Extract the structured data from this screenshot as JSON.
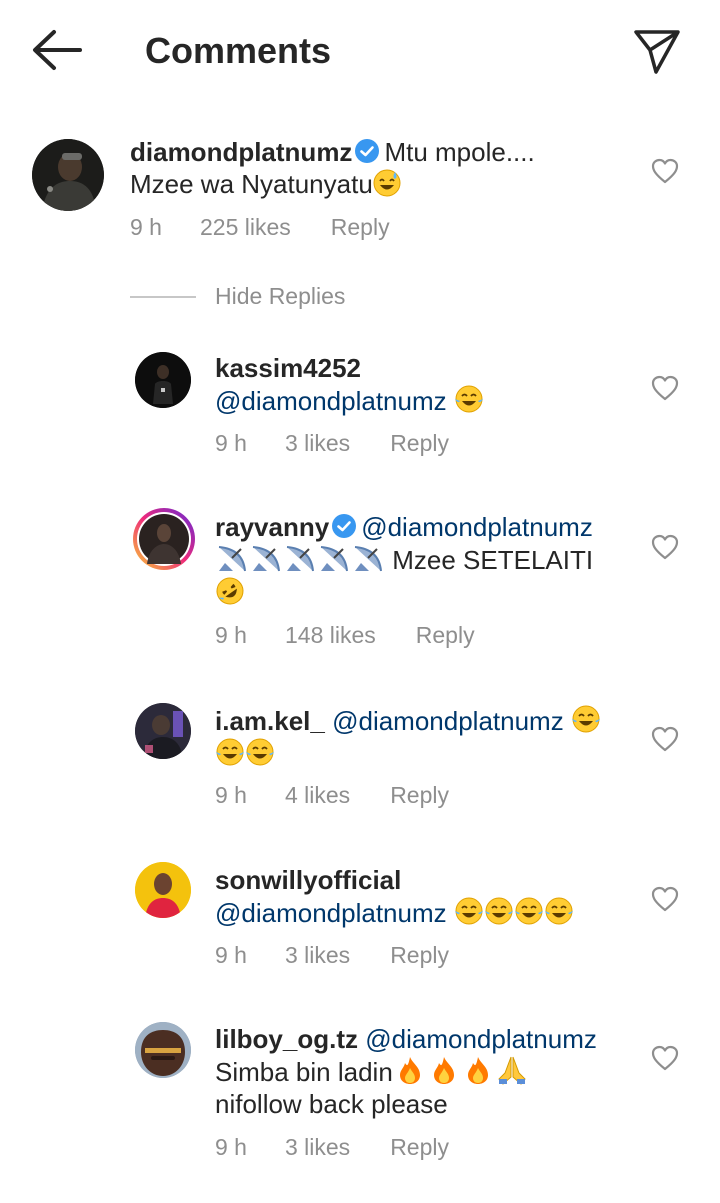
{
  "header": {
    "title": "Comments"
  },
  "hide_replies_label": "Hide Replies",
  "main_comment": {
    "username": "diamondplatnumz",
    "verified": true,
    "text_line1": "Mtu mpole....",
    "text_line2": "Mzee wa Nyatunyatu",
    "emoji": "sweat-smile",
    "time": "9 h",
    "likes": "225 likes",
    "reply": "Reply"
  },
  "replies": [
    {
      "username": "kassim4252",
      "mention": "@diamondplatnumz",
      "text": "",
      "emoji_count": 1,
      "time": "9 h",
      "likes": "3 likes",
      "reply": "Reply"
    },
    {
      "username": "rayvanny",
      "verified": true,
      "mention": "@diamondplatnumz",
      "text": "Mzee SETELAITI",
      "satellite_count": 5,
      "time": "9 h",
      "likes": "148 likes",
      "reply": "Reply"
    },
    {
      "username": "i.am.kel_",
      "mention": "@diamondplatnumz",
      "emoji_count": 3,
      "time": "9 h",
      "likes": "4 likes",
      "reply": "Reply"
    },
    {
      "username": "sonwillyofficial",
      "mention": "@diamondplatnumz",
      "emoji_count": 4,
      "time": "9 h",
      "likes": "3 likes",
      "reply": "Reply"
    },
    {
      "username": "lilboy_og.tz",
      "mention": "@diamondplatnumz",
      "text_line1": "Simba bin ladin",
      "text_line2": "nifollow back please",
      "time": "9 h",
      "likes": "3 likes",
      "reply": "Reply"
    }
  ],
  "colors": {
    "mention": "#00376b",
    "meta": "#8e8e8e",
    "verified": "#3897f0"
  }
}
